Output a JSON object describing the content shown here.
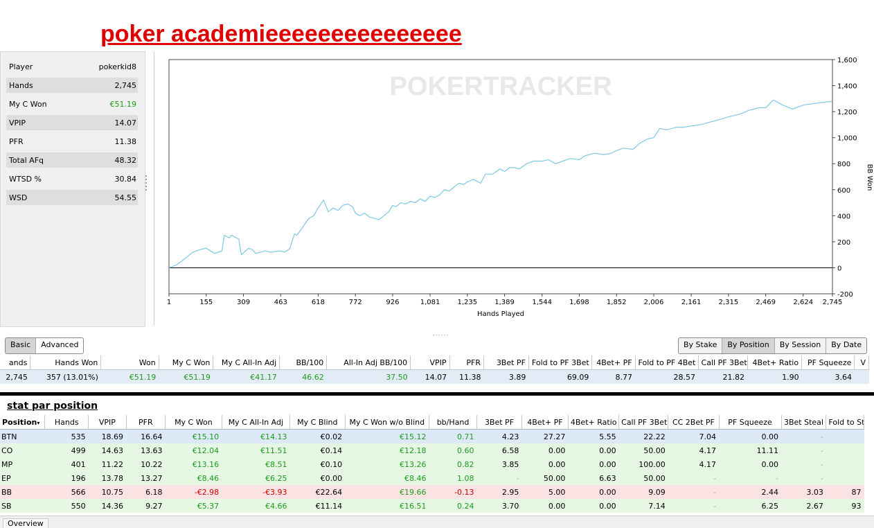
{
  "header": {
    "title": "poker academieeeeeeeeeeeeeee"
  },
  "left_stats": [
    {
      "label": "Player",
      "value": "pokerkid8"
    },
    {
      "label": "Hands",
      "value": "2,745"
    },
    {
      "label": "My C Won",
      "value": "€51.19"
    },
    {
      "label": "VPIP",
      "value": "14.07"
    },
    {
      "label": "PFR",
      "value": "11.38"
    },
    {
      "label": "Total AFq",
      "value": "48.32"
    },
    {
      "label": "WTSD %",
      "value": "30.84"
    },
    {
      "label": "WSD",
      "value": "54.55"
    }
  ],
  "chart_data": {
    "type": "line",
    "watermark": "POKERTRACKER",
    "xlabel": "Hands Played",
    "ylabel": "BB Won",
    "xlim": [
      1,
      2745
    ],
    "ylim": [
      -200,
      1600
    ],
    "x_ticks": [
      "1",
      "155",
      "309",
      "463",
      "618",
      "772",
      "926",
      "1,081",
      "1,235",
      "1,389",
      "1,544",
      "1,698",
      "1,852",
      "2,006",
      "2,161",
      "2,315",
      "2,469",
      "2,624",
      "2,745"
    ],
    "y_ticks": [
      "-200",
      "0",
      "200",
      "400",
      "600",
      "800",
      "1,000",
      "1,200",
      "1,400",
      "1,600"
    ],
    "series": [
      {
        "color": "#7ec8e3",
        "x": [
          1,
          30,
          60,
          100,
          130,
          155,
          190,
          220,
          230,
          250,
          260,
          290,
          300,
          330,
          345,
          360,
          380,
          400,
          420,
          440,
          460,
          480,
          500,
          520,
          530,
          550,
          560,
          580,
          600,
          618,
          640,
          660,
          680,
          700,
          720,
          740,
          760,
          772,
          790,
          810,
          830,
          850,
          870,
          890,
          910,
          926,
          940,
          960,
          980,
          1000,
          1020,
          1040,
          1060,
          1081,
          1100,
          1120,
          1140,
          1160,
          1180,
          1200,
          1220,
          1235,
          1260,
          1290,
          1310,
          1340,
          1370,
          1389,
          1410,
          1430,
          1450,
          1480,
          1510,
          1544,
          1570,
          1600,
          1630,
          1660,
          1698,
          1720,
          1760,
          1800,
          1830,
          1852,
          1880,
          1920,
          1950,
          1980,
          2006,
          2030,
          2060,
          2100,
          2130,
          2161,
          2200,
          2240,
          2280,
          2315,
          2360,
          2400,
          2440,
          2469,
          2480,
          2500,
          2540,
          2580,
          2624,
          2660,
          2700,
          2745
        ],
        "y": [
          0,
          20,
          60,
          120,
          140,
          150,
          110,
          130,
          250,
          230,
          250,
          220,
          100,
          150,
          140,
          110,
          120,
          130,
          120,
          125,
          130,
          120,
          145,
          260,
          250,
          300,
          330,
          380,
          400,
          460,
          520,
          430,
          460,
          440,
          480,
          490,
          470,
          420,
          400,
          420,
          390,
          380,
          370,
          400,
          430,
          480,
          470,
          500,
          490,
          510,
          500,
          530,
          510,
          550,
          540,
          560,
          600,
          590,
          620,
          650,
          640,
          660,
          680,
          650,
          720,
          720,
          760,
          740,
          770,
          770,
          760,
          800,
          820,
          820,
          830,
          800,
          820,
          840,
          830,
          860,
          880,
          870,
          880,
          900,
          920,
          910,
          960,
          990,
          1000,
          1070,
          1060,
          1080,
          1080,
          1090,
          1100,
          1120,
          1140,
          1160,
          1180,
          1210,
          1230,
          1230,
          1250,
          1290,
          1250,
          1220,
          1250,
          1260,
          1270,
          1280
        ]
      }
    ]
  },
  "view_toggle": {
    "basic": "Basic",
    "advanced": "Advanced"
  },
  "group_toggle": {
    "stake": "By Stake",
    "position": "By Position",
    "session": "By Session",
    "date": "By Date"
  },
  "summary_table": {
    "headers": [
      "ands",
      "Hands Won",
      "Won",
      "My C Won",
      "My C All-In Adj",
      "BB/100",
      "All-In Adj BB/100",
      "VPIP",
      "PFR",
      "3Bet PF",
      "Fold to PF 3Bet",
      "4Bet+ PF",
      "Fold to PF 4Bet",
      "Call PF 3Bet",
      "4Bet+ Ratio",
      "PF Squeeze",
      "V"
    ],
    "row": [
      "2,745",
      "357 (13.01%)",
      "€51.19",
      "€51.19",
      "€41.17",
      "46.62",
      "37.50",
      "14.07",
      "11.38",
      "3.89",
      "69.09",
      "8.77",
      "28.57",
      "21.82",
      "1.90",
      "3.64",
      ""
    ]
  },
  "position_section": {
    "title": "stat par position",
    "headers": [
      "Position",
      "Hands",
      "VPIP",
      "PFR",
      "My C Won",
      "My C All-In Adj",
      "My C Blind",
      "My C Won w/o Blind",
      "bb/Hand",
      "3Bet PF",
      "4Bet+ PF",
      "4Bet+ Ratio",
      "Call PF 3Bet",
      "CC 2Bet PF",
      "PF Squeeze",
      "3Bet Steal",
      "Fold to St"
    ],
    "rows": [
      {
        "style": "blue",
        "cells": [
          "BTN",
          "535",
          "18.69",
          "16.64",
          "€15.10",
          "€14.13",
          "€0.02",
          "€15.12",
          "0.71",
          "4.23",
          "27.27",
          "5.55",
          "22.22",
          "7.04",
          "0.00",
          "-",
          ""
        ]
      },
      {
        "style": "green",
        "cells": [
          "CO",
          "499",
          "14.63",
          "13.63",
          "€12.04",
          "€11.51",
          "€0.14",
          "€12.18",
          "0.60",
          "6.58",
          "0.00",
          "0.00",
          "50.00",
          "4.17",
          "11.11",
          "-",
          ""
        ]
      },
      {
        "style": "green",
        "cells": [
          "MP",
          "401",
          "11.22",
          "10.22",
          "€13.16",
          "€8.51",
          "€0.10",
          "€13.26",
          "0.82",
          "3.85",
          "0.00",
          "0.00",
          "100.00",
          "4.17",
          "0.00",
          "-",
          ""
        ]
      },
      {
        "style": "green",
        "cells": [
          "EP",
          "196",
          "13.78",
          "13.27",
          "€8.46",
          "€6.25",
          "€0.00",
          "€8.46",
          "1.08",
          "-",
          "50.00",
          "6.63",
          "50.00",
          "-",
          "-",
          "-",
          ""
        ]
      },
      {
        "style": "red",
        "cells": [
          "BB",
          "566",
          "10.75",
          "6.18",
          "-€2.98",
          "-€3.93",
          "€22.64",
          "€19.66",
          "-0.13",
          "2.95",
          "5.00",
          "0.00",
          "9.09",
          "-",
          "2.44",
          "3.03",
          "87"
        ]
      },
      {
        "style": "green",
        "cells": [
          "SB",
          "550",
          "14.36",
          "9.27",
          "€5.37",
          "€4.66",
          "€11.14",
          "€16.51",
          "0.24",
          "3.70",
          "0.00",
          "0.00",
          "7.14",
          "-",
          "6.25",
          "2.67",
          "93"
        ]
      }
    ]
  },
  "bottom_tab": {
    "label": "Overview"
  }
}
